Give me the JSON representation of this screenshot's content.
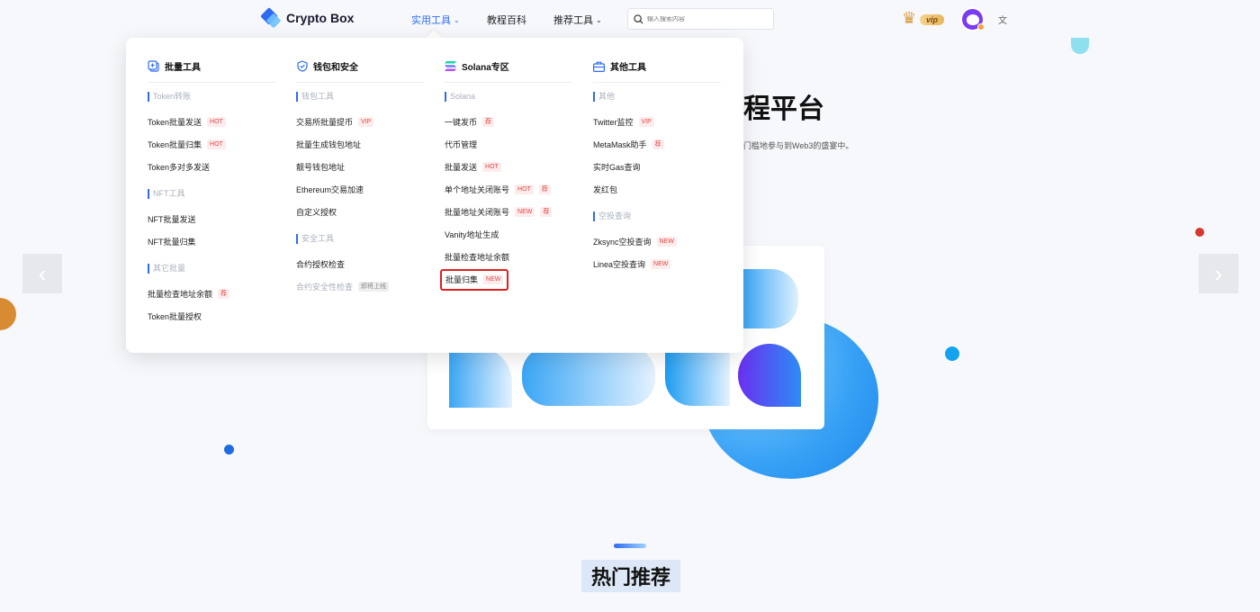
{
  "header": {
    "logo_text": "Crypto Box",
    "nav": [
      {
        "label": "实用工具",
        "has_dropdown": true,
        "active": true
      },
      {
        "label": "教程百科",
        "has_dropdown": false,
        "active": false
      },
      {
        "label": "推荐工具",
        "has_dropdown": true,
        "active": false
      }
    ],
    "search_placeholder": "输入搜索内容",
    "vip_label": "vip",
    "lang_icon": "translate-icon"
  },
  "hero": {
    "title_fragment": "程平台",
    "subtitle_fragment": "门槛地参与到Web3的盛宴中。"
  },
  "hot_section_title": "热门推荐",
  "dropdown": {
    "columns": [
      {
        "title": "批量工具",
        "icon": "batch-icon",
        "sections": [
          {
            "name": "Token转账",
            "items": [
              {
                "label": "Token批量发送",
                "tags": [
                  "HOT"
                ]
              },
              {
                "label": "Token批量归集",
                "tags": [
                  "HOT"
                ]
              },
              {
                "label": "Token多对多发送",
                "tags": []
              }
            ]
          },
          {
            "name": "NFT工具",
            "items": [
              {
                "label": "NFT批量发送",
                "tags": []
              },
              {
                "label": "NFT批量归集",
                "tags": []
              }
            ]
          },
          {
            "name": "其它批量",
            "items": [
              {
                "label": "批量检查地址余额",
                "tags": [
                  "荐"
                ]
              },
              {
                "label": "Token批量授权",
                "tags": []
              }
            ]
          }
        ]
      },
      {
        "title": "钱包和安全",
        "icon": "shield-icon",
        "sections": [
          {
            "name": "钱包工具",
            "items": [
              {
                "label": "交易所批量提币",
                "tags": [
                  "VIP"
                ]
              },
              {
                "label": "批量生成钱包地址",
                "tags": []
              },
              {
                "label": "靓号钱包地址",
                "tags": []
              },
              {
                "label": "Ethereum交易加速",
                "tags": []
              },
              {
                "label": "自定义授权",
                "tags": []
              }
            ]
          },
          {
            "name": "安全工具",
            "items": [
              {
                "label": "合约授权检查",
                "tags": []
              },
              {
                "label": "合约安全性检查",
                "tags": [
                  "即将上线"
                ],
                "disabled": true
              }
            ]
          }
        ]
      },
      {
        "title": "Solana专区",
        "icon": "solana-icon",
        "sections": [
          {
            "name": "Solana",
            "items": [
              {
                "label": "一键发币",
                "tags": [
                  "荐"
                ]
              },
              {
                "label": "代币管理",
                "tags": []
              },
              {
                "label": "批量发送",
                "tags": [
                  "HOT"
                ]
              },
              {
                "label": "单个地址关闭账号",
                "tags": [
                  "HOT",
                  "荐"
                ]
              },
              {
                "label": "批量地址关闭账号",
                "tags": [
                  "NEW",
                  "荐"
                ]
              },
              {
                "label": "Vanity地址生成",
                "tags": []
              },
              {
                "label": "批量检查地址余额",
                "tags": []
              },
              {
                "label": "批量归集",
                "tags": [
                  "NEW"
                ],
                "highlighted": true
              }
            ]
          }
        ]
      },
      {
        "title": "其他工具",
        "icon": "toolbox-icon",
        "sections": [
          {
            "name": "其他",
            "items": [
              {
                "label": "Twitter监控",
                "tags": [
                  "VIP"
                ]
              },
              {
                "label": "MetaMask助手",
                "tags": [
                  "荐"
                ]
              },
              {
                "label": "实时Gas查询",
                "tags": []
              },
              {
                "label": "发红包",
                "tags": []
              }
            ]
          },
          {
            "name": "空投查询",
            "items": [
              {
                "label": "Zksync空投查询",
                "tags": [
                  "NEW"
                ]
              },
              {
                "label": "Linea空投查询",
                "tags": [
                  "NEW"
                ]
              }
            ]
          }
        ]
      }
    ]
  },
  "colors": {
    "accent": "#2f6bf2",
    "tag_red": "#e64545",
    "highlight_border": "#e02020"
  }
}
